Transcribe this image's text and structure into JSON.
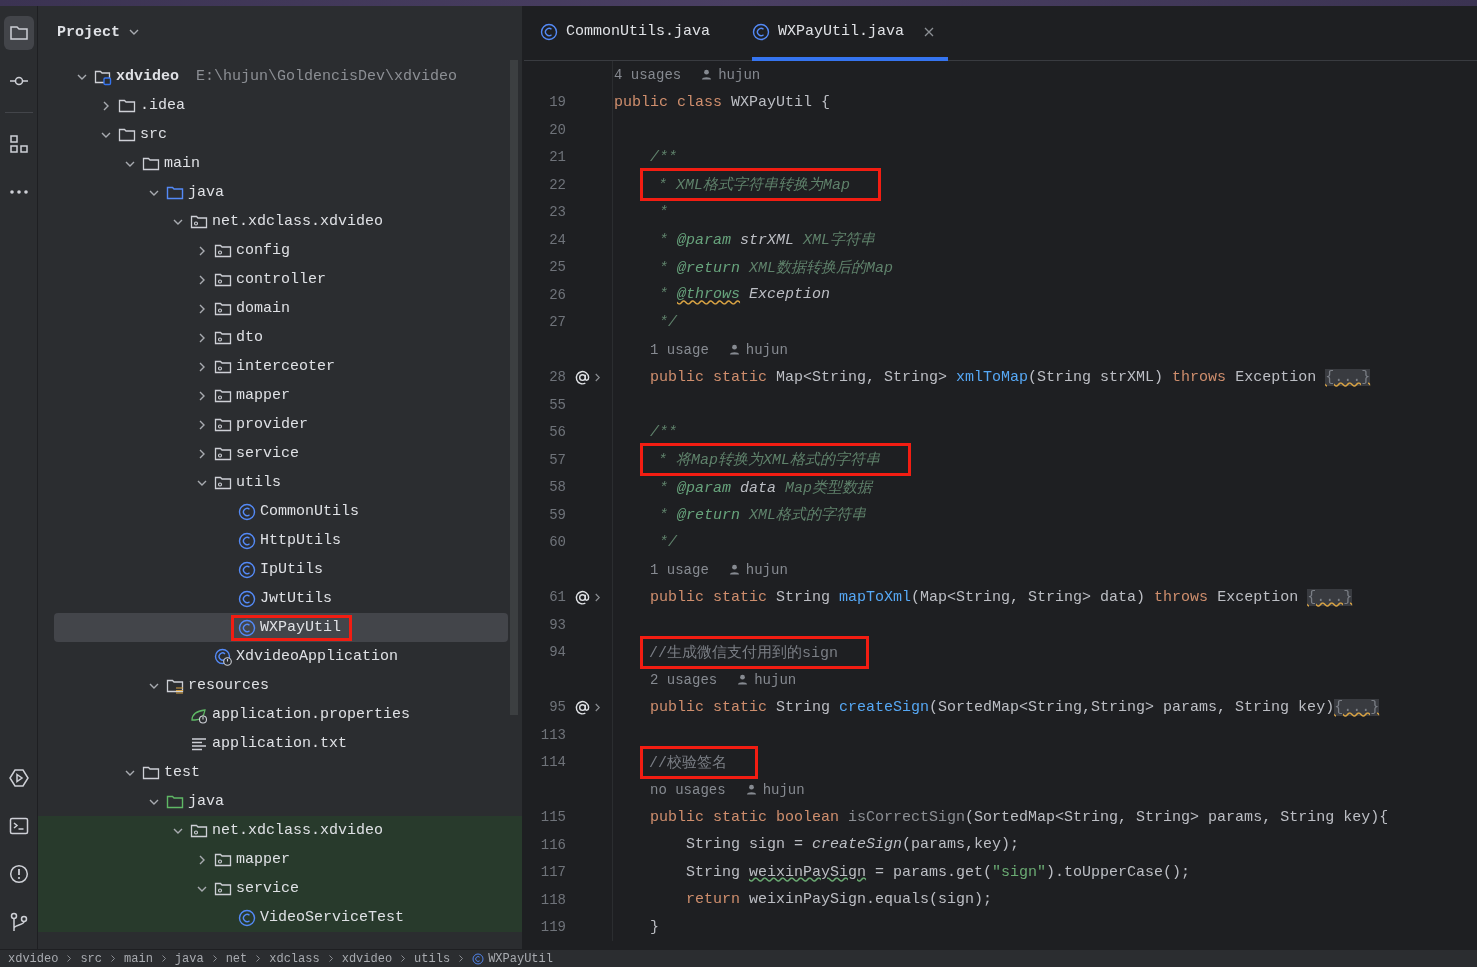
{
  "tool_windows": [
    {
      "kind": "project",
      "selected": true
    },
    {
      "kind": "commit",
      "selected": false
    },
    {
      "kind": "structure",
      "selected": false
    },
    {
      "kind": "more",
      "selected": false
    },
    {
      "kind": "run",
      "selected": false
    },
    {
      "kind": "terminal",
      "selected": false
    },
    {
      "kind": "problems",
      "selected": false
    },
    {
      "kind": "git",
      "selected": false
    }
  ],
  "project_panel": {
    "title": "Project",
    "tree": [
      {
        "label": "xdvideo",
        "path": "E:\\hujun\\GoldencisDev\\xdvideo",
        "kind": "module",
        "expanded": true,
        "selected": false,
        "children": [
          {
            "label": ".idea",
            "kind": "folder",
            "expanded": false,
            "selected": false
          },
          {
            "label": "src",
            "kind": "folder",
            "expanded": true,
            "selected": false,
            "children": [
              {
                "label": "main",
                "kind": "folder",
                "expanded": true,
                "selected": false,
                "children": [
                  {
                    "label": "java",
                    "kind": "source-root",
                    "expanded": true,
                    "selected": false,
                    "children": [
                      {
                        "label": "net.xdclass.xdvideo",
                        "kind": "package",
                        "expanded": true,
                        "selected": false,
                        "children": [
                          {
                            "label": "config",
                            "kind": "package",
                            "expanded": false,
                            "selected": false
                          },
                          {
                            "label": "controller",
                            "kind": "package",
                            "expanded": false,
                            "selected": false
                          },
                          {
                            "label": "domain",
                            "kind": "package",
                            "expanded": false,
                            "selected": false
                          },
                          {
                            "label": "dto",
                            "kind": "package",
                            "expanded": false,
                            "selected": false
                          },
                          {
                            "label": "interceoter",
                            "kind": "package",
                            "expanded": false,
                            "selected": false
                          },
                          {
                            "label": "mapper",
                            "kind": "package",
                            "expanded": false,
                            "selected": false
                          },
                          {
                            "label": "provider",
                            "kind": "package",
                            "expanded": false,
                            "selected": false
                          },
                          {
                            "label": "service",
                            "kind": "package",
                            "expanded": false,
                            "selected": false
                          },
                          {
                            "label": "utils",
                            "kind": "package",
                            "expanded": true,
                            "selected": false,
                            "children": [
                              {
                                "label": "CommonUtils",
                                "kind": "class",
                                "selected": false
                              },
                              {
                                "label": "HttpUtils",
                                "kind": "class",
                                "selected": false
                              },
                              {
                                "label": "IpUtils",
                                "kind": "class",
                                "selected": false
                              },
                              {
                                "label": "JwtUtils",
                                "kind": "class",
                                "selected": false
                              },
                              {
                                "label": "WXPayUtil",
                                "kind": "class",
                                "selected": true,
                                "boxed": true
                              }
                            ]
                          },
                          {
                            "label": "XdvideoApplication",
                            "kind": "spring-class",
                            "selected": false
                          }
                        ]
                      }
                    ]
                  },
                  {
                    "label": "resources",
                    "kind": "resources",
                    "expanded": true,
                    "selected": false,
                    "children": [
                      {
                        "label": "application.properties",
                        "kind": "spring-props",
                        "selected": false
                      },
                      {
                        "label": "application.txt",
                        "kind": "text",
                        "selected": false
                      }
                    ]
                  }
                ]
              },
              {
                "label": "test",
                "kind": "folder",
                "expanded": true,
                "selected": false,
                "children": [
                  {
                    "label": "java",
                    "kind": "test-root",
                    "expanded": true,
                    "selected": false,
                    "children": [
                      {
                        "label": "net.xdclass.xdvideo",
                        "kind": "package",
                        "expanded": true,
                        "selected": false,
                        "children": [
                          {
                            "label": "mapper",
                            "kind": "package",
                            "expanded": false,
                            "selected": false
                          },
                          {
                            "label": "service",
                            "kind": "package",
                            "expanded": true,
                            "selected": false,
                            "children": [
                              {
                                "label": "VideoServiceTest",
                                "kind": "class",
                                "selected": false
                              }
                            ]
                          }
                        ]
                      }
                    ]
                  }
                ]
              }
            ]
          }
        ]
      }
    ]
  },
  "tabs": [
    {
      "label": "CommonUtils.java",
      "selected": false,
      "closable": false
    },
    {
      "label": "WXPayUtil.java",
      "selected": true,
      "closable": true
    }
  ],
  "code": [
    {
      "kind": "hint",
      "usages": "4 usages",
      "author": "hujun"
    },
    {
      "kind": "code",
      "num": "19",
      "tokens": [
        {
          "t": "public class ",
          "kind": "kw"
        },
        {
          "t": "WXPayUtil {",
          "kind": "plain"
        }
      ],
      "children": [
        {
          "kind": "code",
          "num": "20"
        },
        {
          "kind": "code",
          "num": "21",
          "tokens": [
            {
              "t": "/**",
              "kind": "doc"
            }
          ]
        },
        {
          "kind": "code",
          "num": "22",
          "boxed": true,
          "tokens": [
            {
              "t": " * XML格式字符串转换为Map",
              "kind": "doc"
            }
          ]
        },
        {
          "kind": "code",
          "num": "23",
          "tokens": [
            {
              "t": " *",
              "kind": "doc"
            }
          ]
        },
        {
          "kind": "code",
          "num": "24",
          "tokens": [
            {
              "t": " * ",
              "kind": "doc"
            },
            {
              "t": "@param",
              "kind": "doctag"
            },
            {
              "t": " strXML ",
              "kind": "docvalue"
            },
            {
              "t": "XML字符串",
              "kind": "doc"
            }
          ]
        },
        {
          "kind": "code",
          "num": "25",
          "tokens": [
            {
              "t": " * ",
              "kind": "doc"
            },
            {
              "t": "@return",
              "kind": "doctag"
            },
            {
              "t": " XML数据转换后的Map",
              "kind": "doc"
            }
          ]
        },
        {
          "kind": "code",
          "num": "26",
          "tokens": [
            {
              "t": " * ",
              "kind": "doc"
            },
            {
              "t": "@throws",
              "kind": "doctag-warn"
            },
            {
              "t": " Exception",
              "kind": "docvalue"
            }
          ]
        },
        {
          "kind": "code",
          "num": "27",
          "tokens": [
            {
              "t": " */",
              "kind": "doc"
            }
          ]
        },
        {
          "kind": "hint",
          "usages": "1 usage",
          "author": "hujun"
        },
        {
          "kind": "code",
          "num": "28",
          "gutter_mark": true,
          "tokens": [
            {
              "t": "public static ",
              "kind": "kw"
            },
            {
              "t": "Map<String, String> ",
              "kind": "plain"
            },
            {
              "t": "xmlToMap",
              "kind": "fn"
            },
            {
              "t": "(String strXML) ",
              "kind": "plain"
            },
            {
              "t": "throws ",
              "kind": "kw"
            },
            {
              "t": "Exception ",
              "kind": "plain"
            },
            {
              "t": "{...}",
              "kind": "fold"
            }
          ]
        },
        {
          "kind": "code",
          "num": "55"
        },
        {
          "kind": "code",
          "num": "56",
          "tokens": [
            {
              "t": "/**",
              "kind": "doc"
            }
          ]
        },
        {
          "kind": "code",
          "num": "57",
          "boxed": true,
          "tokens": [
            {
              "t": " * 将Map转换为XML格式的字符串",
              "kind": "doc"
            }
          ]
        },
        {
          "kind": "code",
          "num": "58",
          "tokens": [
            {
              "t": " * ",
              "kind": "doc"
            },
            {
              "t": "@param",
              "kind": "doctag"
            },
            {
              "t": " data ",
              "kind": "docvalue"
            },
            {
              "t": "Map类型数据",
              "kind": "doc"
            }
          ]
        },
        {
          "kind": "code",
          "num": "59",
          "tokens": [
            {
              "t": " * ",
              "kind": "doc"
            },
            {
              "t": "@return",
              "kind": "doctag"
            },
            {
              "t": " XML格式的字符串",
              "kind": "doc"
            }
          ]
        },
        {
          "kind": "code",
          "num": "60",
          "tokens": [
            {
              "t": " */",
              "kind": "doc"
            }
          ]
        },
        {
          "kind": "hint",
          "usages": "1 usage",
          "author": "hujun"
        },
        {
          "kind": "code",
          "num": "61",
          "gutter_mark": true,
          "tokens": [
            {
              "t": "public static ",
              "kind": "kw"
            },
            {
              "t": "String ",
              "kind": "plain"
            },
            {
              "t": "mapToXml",
              "kind": "fn"
            },
            {
              "t": "(Map<String, String> data) ",
              "kind": "plain"
            },
            {
              "t": "throws ",
              "kind": "kw"
            },
            {
              "t": "Exception ",
              "kind": "plain"
            },
            {
              "t": "{...}",
              "kind": "fold"
            }
          ]
        },
        {
          "kind": "code",
          "num": "93"
        },
        {
          "kind": "code",
          "num": "94",
          "boxed": true,
          "tokens": [
            {
              "t": "//生成微信支付用到的sign",
              "kind": "comment"
            }
          ]
        },
        {
          "kind": "hint",
          "usages": "2 usages",
          "author": "hujun"
        },
        {
          "kind": "code",
          "num": "95",
          "gutter_mark": true,
          "tokens": [
            {
              "t": "public static ",
              "kind": "kw"
            },
            {
              "t": "String ",
              "kind": "plain"
            },
            {
              "t": "createSign",
              "kind": "fn"
            },
            {
              "t": "(SortedMap<String,String> params, String key)",
              "kind": "plain"
            },
            {
              "t": "{...}",
              "kind": "fold"
            }
          ]
        },
        {
          "kind": "code",
          "num": "113"
        },
        {
          "kind": "code",
          "num": "114",
          "boxed": true,
          "tokens": [
            {
              "t": "//校验签名",
              "kind": "comment"
            }
          ]
        },
        {
          "kind": "hint",
          "usages": "no usages",
          "author": "hujun"
        },
        {
          "kind": "code",
          "num": "115",
          "tokens": [
            {
              "t": "public static boolean ",
              "kind": "kw"
            },
            {
              "t": "isCorrectSign",
              "kind": "unused"
            },
            {
              "t": "(SortedMap<String, String> params, String key){",
              "kind": "plain"
            }
          ],
          "children": [
            {
              "kind": "code",
              "num": "116",
              "tokens": [
                {
                  "t": "String sign = ",
                  "kind": "plain"
                },
                {
                  "t": "createSign",
                  "kind": "call"
                },
                {
                  "t": "(params,key);",
                  "kind": "plain"
                }
              ]
            },
            {
              "kind": "code",
              "num": "117",
              "tokens": [
                {
                  "t": "String ",
                  "kind": "plain"
                },
                {
                  "t": "weixinPaySign",
                  "kind": "typo"
                },
                {
                  "t": " = params.get(",
                  "kind": "plain"
                },
                {
                  "t": "\"sign\"",
                  "kind": "str"
                },
                {
                  "t": ").toUpperCase();",
                  "kind": "plain"
                }
              ]
            },
            {
              "kind": "code",
              "num": "118",
              "tokens": [
                {
                  "t": "return ",
                  "kind": "kw"
                },
                {
                  "t": "weixinPaySign.equals(sign);",
                  "kind": "plain"
                }
              ]
            }
          ]
        },
        {
          "kind": "code",
          "num": "119",
          "tokens": [
            {
              "t": "}",
              "kind": "plain"
            }
          ]
        }
      ]
    }
  ],
  "breadcrumb": [
    "xdvideo",
    "src",
    "main",
    "java",
    "net",
    "xdclass",
    "xdvideo",
    "utils",
    "WXPayUtil"
  ]
}
